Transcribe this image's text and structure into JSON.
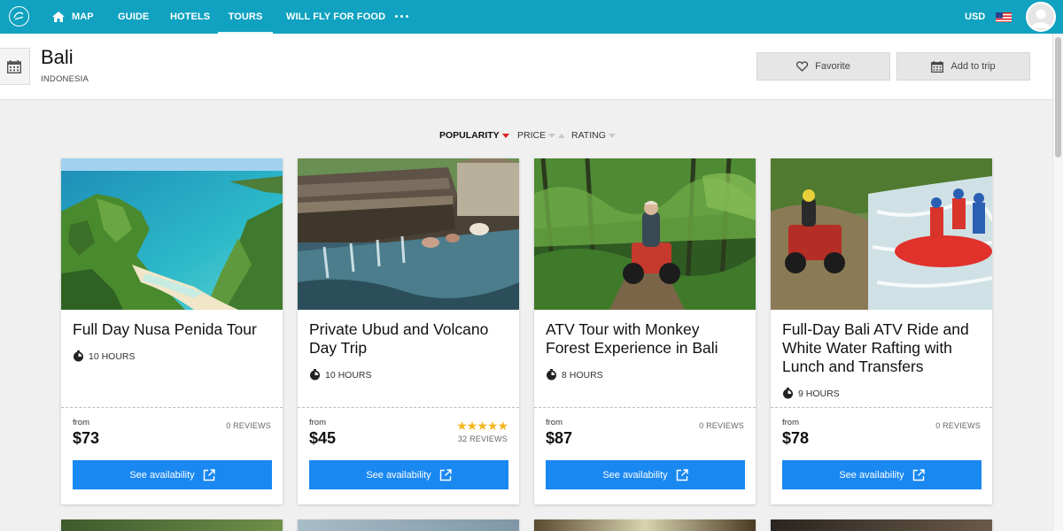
{
  "nav": {
    "items": [
      {
        "label": "MAP"
      },
      {
        "label": "GUIDE"
      },
      {
        "label": "HOTELS"
      },
      {
        "label": "TOURS"
      },
      {
        "label": "WILL FLY FOR FOOD"
      }
    ],
    "active": "TOURS",
    "currency": "USD",
    "accent_color": "#10a2c0"
  },
  "header": {
    "title": "Bali",
    "subtitle": "INDONESIA",
    "favorite_label": "Favorite",
    "add_trip_label": "Add to trip"
  },
  "sort": {
    "options": [
      {
        "label": "POPULARITY"
      },
      {
        "label": "PRICE"
      },
      {
        "label": "RATING"
      }
    ],
    "active": "POPULARITY",
    "active_color": "#e02020"
  },
  "tours": [
    {
      "title": "Full Day Nusa Penida Tour",
      "duration": "10 HOURS",
      "from": "from",
      "price": "$73",
      "reviews": "0 REVIEWS",
      "button": "See availability"
    },
    {
      "title": "Private Ubud and Volcano Day Trip",
      "duration": "10 HOURS",
      "from": "from",
      "price": "$45",
      "rating_stars": 5,
      "reviews": "32 REVIEWS",
      "button": "See availability"
    },
    {
      "title": "ATV Tour with Monkey Forest Experience in Bali",
      "duration": "8 HOURS",
      "from": "from",
      "price": "$87",
      "reviews": "0 REVIEWS",
      "button": "See availability"
    },
    {
      "title": "Full-Day Bali ATV Ride and White Water Rafting with Lunch and Transfers",
      "duration": "9 HOURS",
      "from": "from",
      "price": "$78",
      "reviews": "0 REVIEWS",
      "button": "See availability"
    }
  ],
  "button_color": "#1a88f1"
}
